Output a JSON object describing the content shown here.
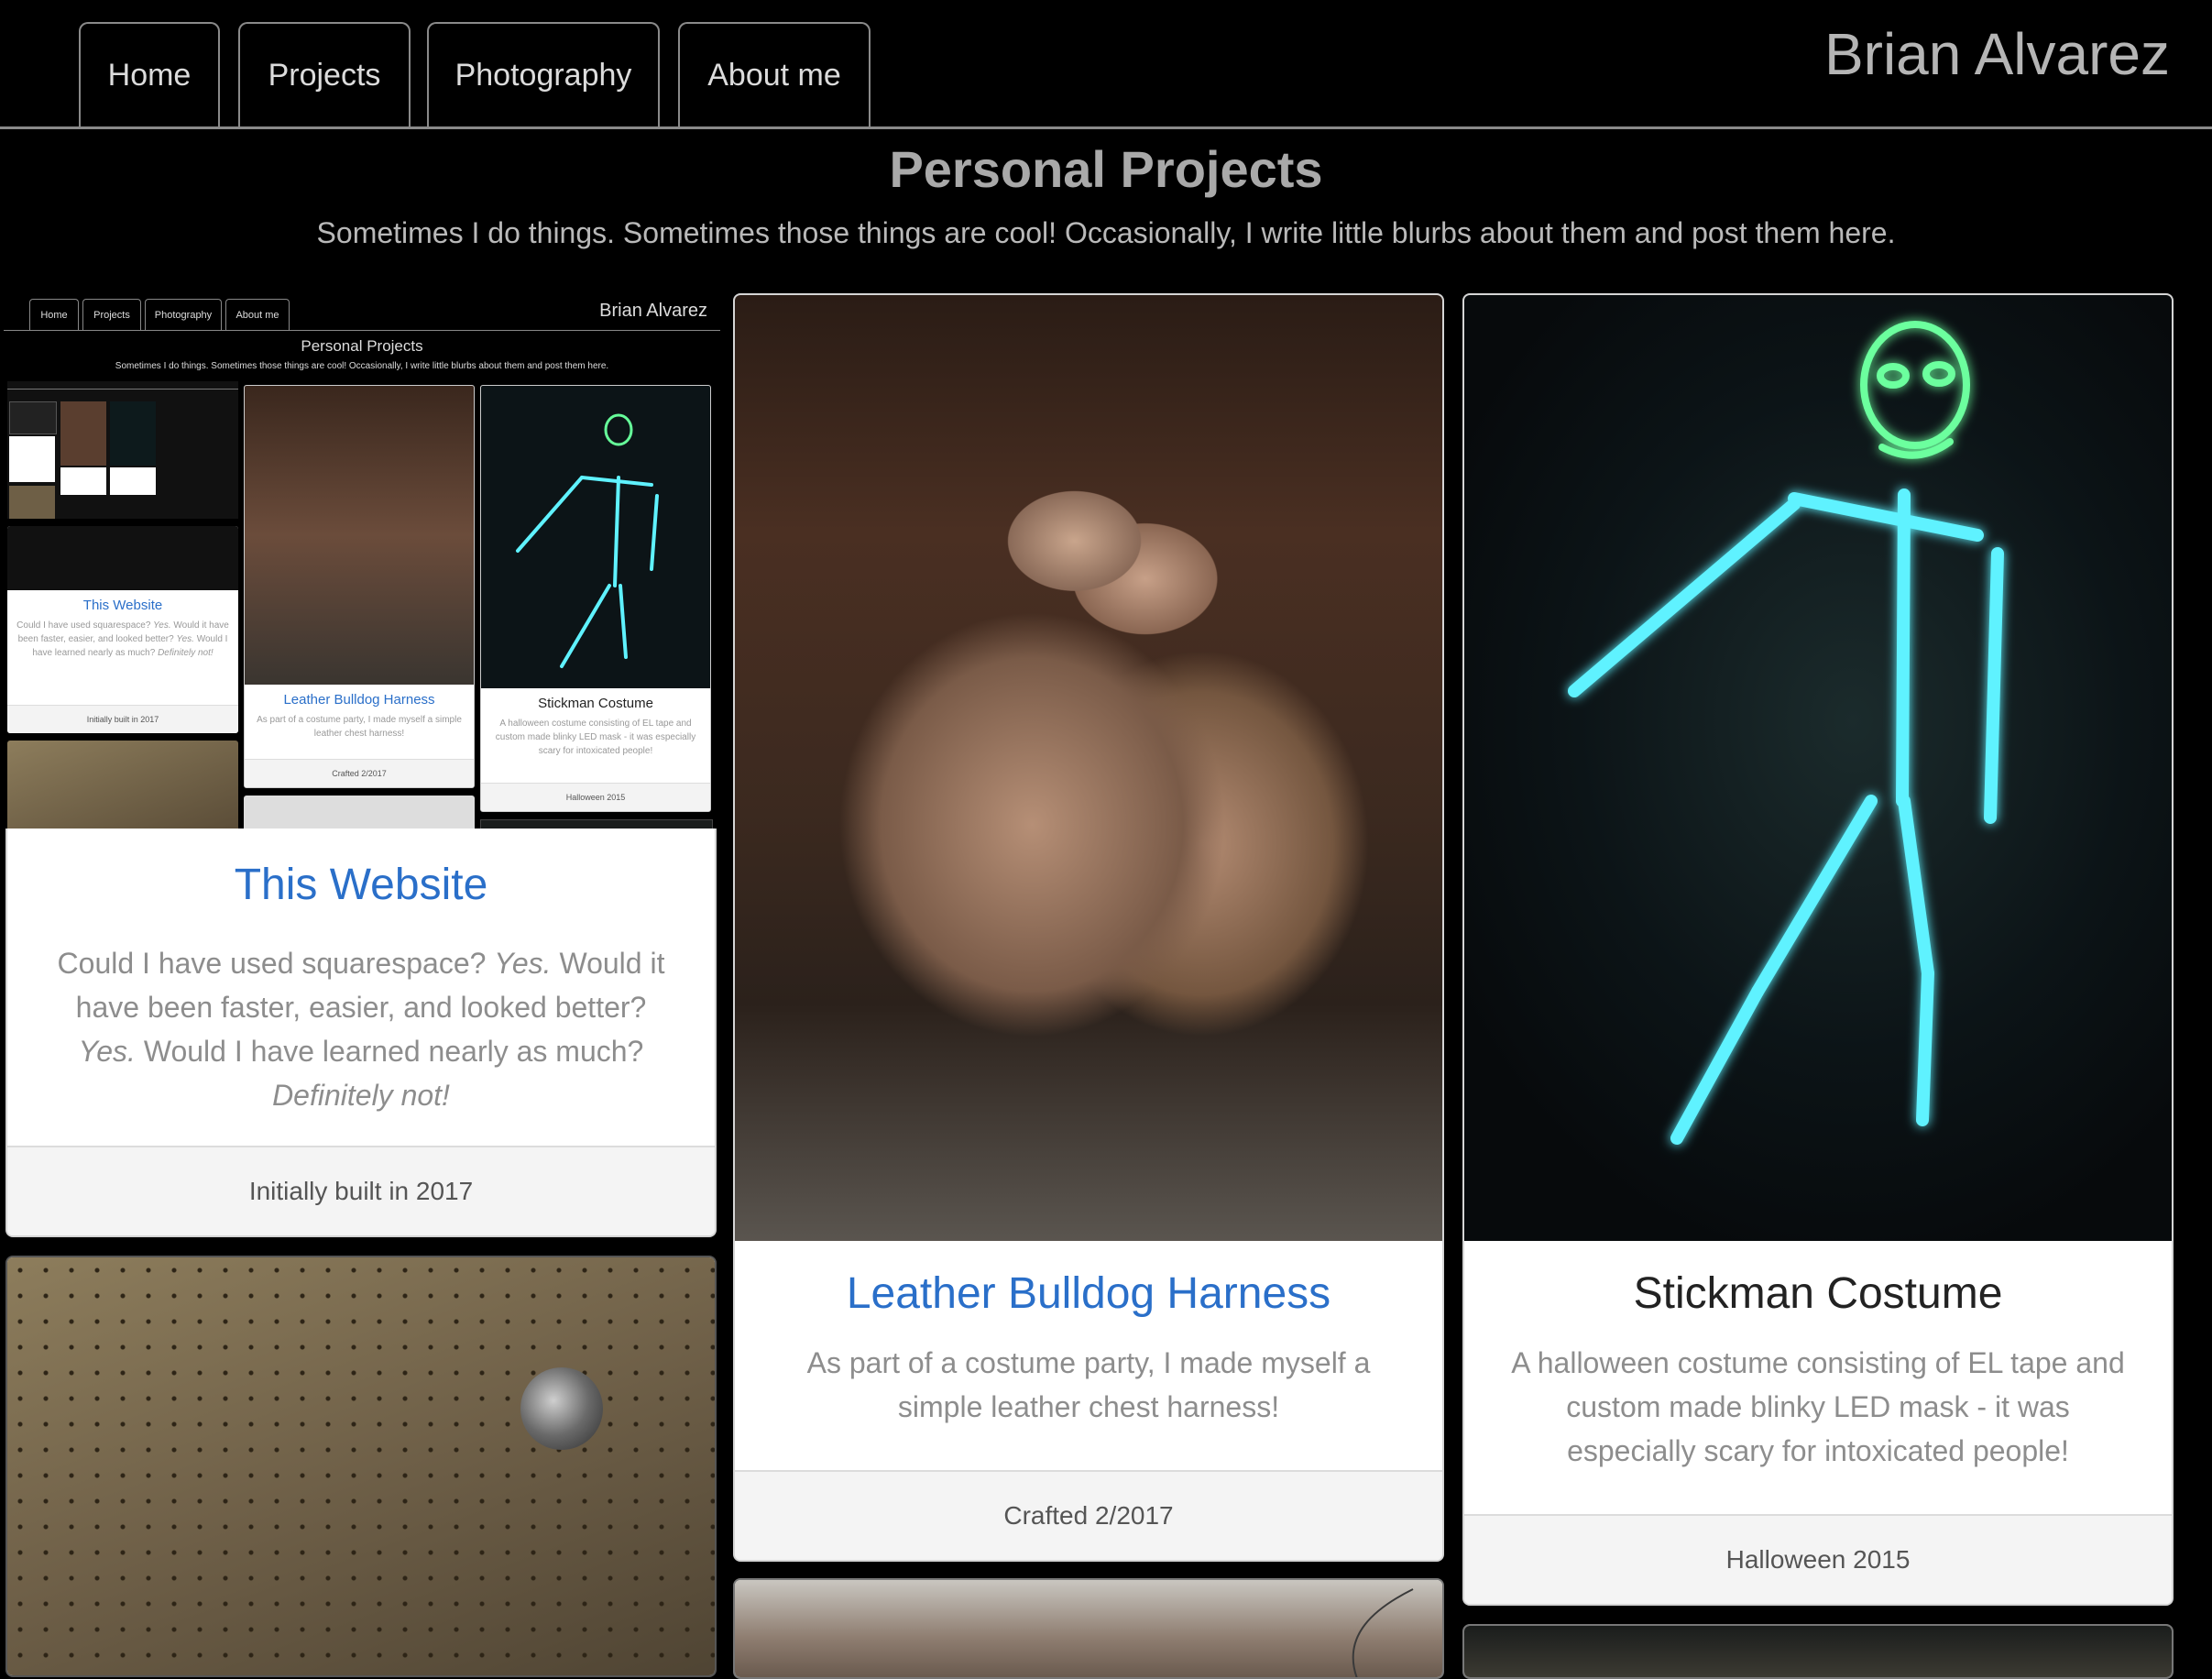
{
  "nav": {
    "tabs": [
      {
        "label": "Home"
      },
      {
        "label": "Projects"
      },
      {
        "label": "Photography"
      },
      {
        "label": "About me"
      }
    ],
    "brand": "Brian Alvarez"
  },
  "page": {
    "title": "Personal Projects",
    "subtitle": "Sometimes I do things. Sometimes those things are cool! Occasionally, I write little blurbs about them and post them here."
  },
  "cards": {
    "website": {
      "title": "This Website",
      "text_1": "Could I have used squarespace? ",
      "text_2": "Yes.",
      "text_3": " Would it have been faster, easier, and looked better? ",
      "text_4": "Yes.",
      "text_5": " Would I have learned nearly as much? ",
      "text_6": "Definitely not!",
      "footer": "Initially built in 2017"
    },
    "harness": {
      "title": "Leather Bulldog Harness",
      "text": "As part of a costume party, I made myself a simple leather chest harness!",
      "footer": "Crafted 2/2017"
    },
    "stickman": {
      "title": "Stickman Costume",
      "text": "A halloween costume consisting of EL tape and custom made blinky LED mask - it was especially scary for intoxicated people!",
      "footer": "Halloween 2015"
    }
  },
  "colors": {
    "background": "#000000",
    "link": "#2a6fc9",
    "glow": "#5ff2ff"
  }
}
